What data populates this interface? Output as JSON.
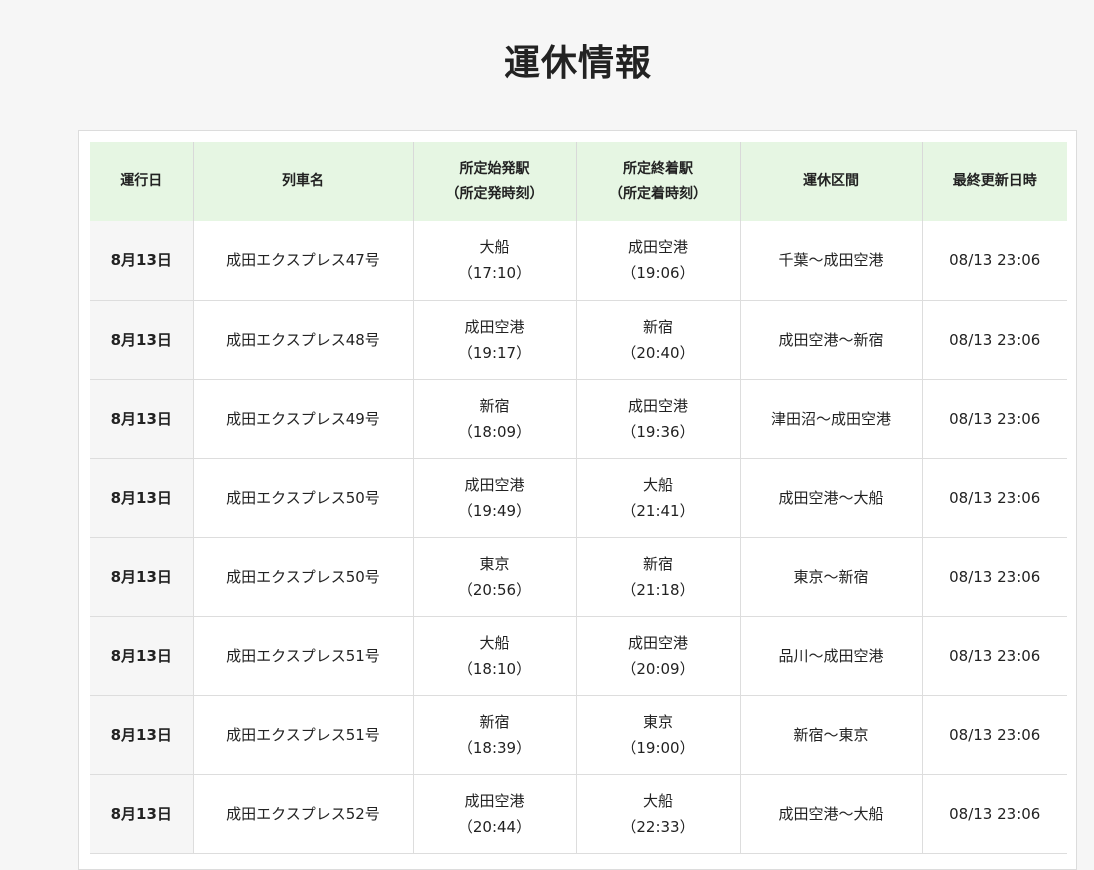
{
  "title": "運休情報",
  "table": {
    "headers": [
      {
        "line1": "運行日",
        "line2": ""
      },
      {
        "line1": "列車名",
        "line2": ""
      },
      {
        "line1": "所定始発駅",
        "line2": "（所定発時刻）"
      },
      {
        "line1": "所定終着駅",
        "line2": "（所定着時刻）"
      },
      {
        "line1": "運休区間",
        "line2": ""
      },
      {
        "line1": "最終更新日時",
        "line2": ""
      }
    ],
    "rows": [
      {
        "date": "8月13日",
        "train": "成田エクスプレス47号",
        "origin": "大船",
        "origin_time": "（17:10）",
        "dest": "成田空港",
        "dest_time": "（19:06）",
        "section": "千葉～成田空港",
        "updated": "08/13 23:06"
      },
      {
        "date": "8月13日",
        "train": "成田エクスプレス48号",
        "origin": "成田空港",
        "origin_time": "（19:17）",
        "dest": "新宿",
        "dest_time": "（20:40）",
        "section": "成田空港～新宿",
        "updated": "08/13 23:06"
      },
      {
        "date": "8月13日",
        "train": "成田エクスプレス49号",
        "origin": "新宿",
        "origin_time": "（18:09）",
        "dest": "成田空港",
        "dest_time": "（19:36）",
        "section": "津田沼～成田空港",
        "updated": "08/13 23:06"
      },
      {
        "date": "8月13日",
        "train": "成田エクスプレス50号",
        "origin": "成田空港",
        "origin_time": "（19:49）",
        "dest": "大船",
        "dest_time": "（21:41）",
        "section": "成田空港～大船",
        "updated": "08/13 23:06"
      },
      {
        "date": "8月13日",
        "train": "成田エクスプレス50号",
        "origin": "東京",
        "origin_time": "（20:56）",
        "dest": "新宿",
        "dest_time": "（21:18）",
        "section": "東京～新宿",
        "updated": "08/13 23:06"
      },
      {
        "date": "8月13日",
        "train": "成田エクスプレス51号",
        "origin": "大船",
        "origin_time": "（18:10）",
        "dest": "成田空港",
        "dest_time": "（20:09）",
        "section": "品川～成田空港",
        "updated": "08/13 23:06"
      },
      {
        "date": "8月13日",
        "train": "成田エクスプレス51号",
        "origin": "新宿",
        "origin_time": "（18:39）",
        "dest": "東京",
        "dest_time": "（19:00）",
        "section": "新宿～東京",
        "updated": "08/13 23:06"
      },
      {
        "date": "8月13日",
        "train": "成田エクスプレス52号",
        "origin": "成田空港",
        "origin_time": "（20:44）",
        "dest": "大船",
        "dest_time": "（22:33）",
        "section": "成田空港～大船",
        "updated": "08/13 23:06"
      }
    ]
  }
}
